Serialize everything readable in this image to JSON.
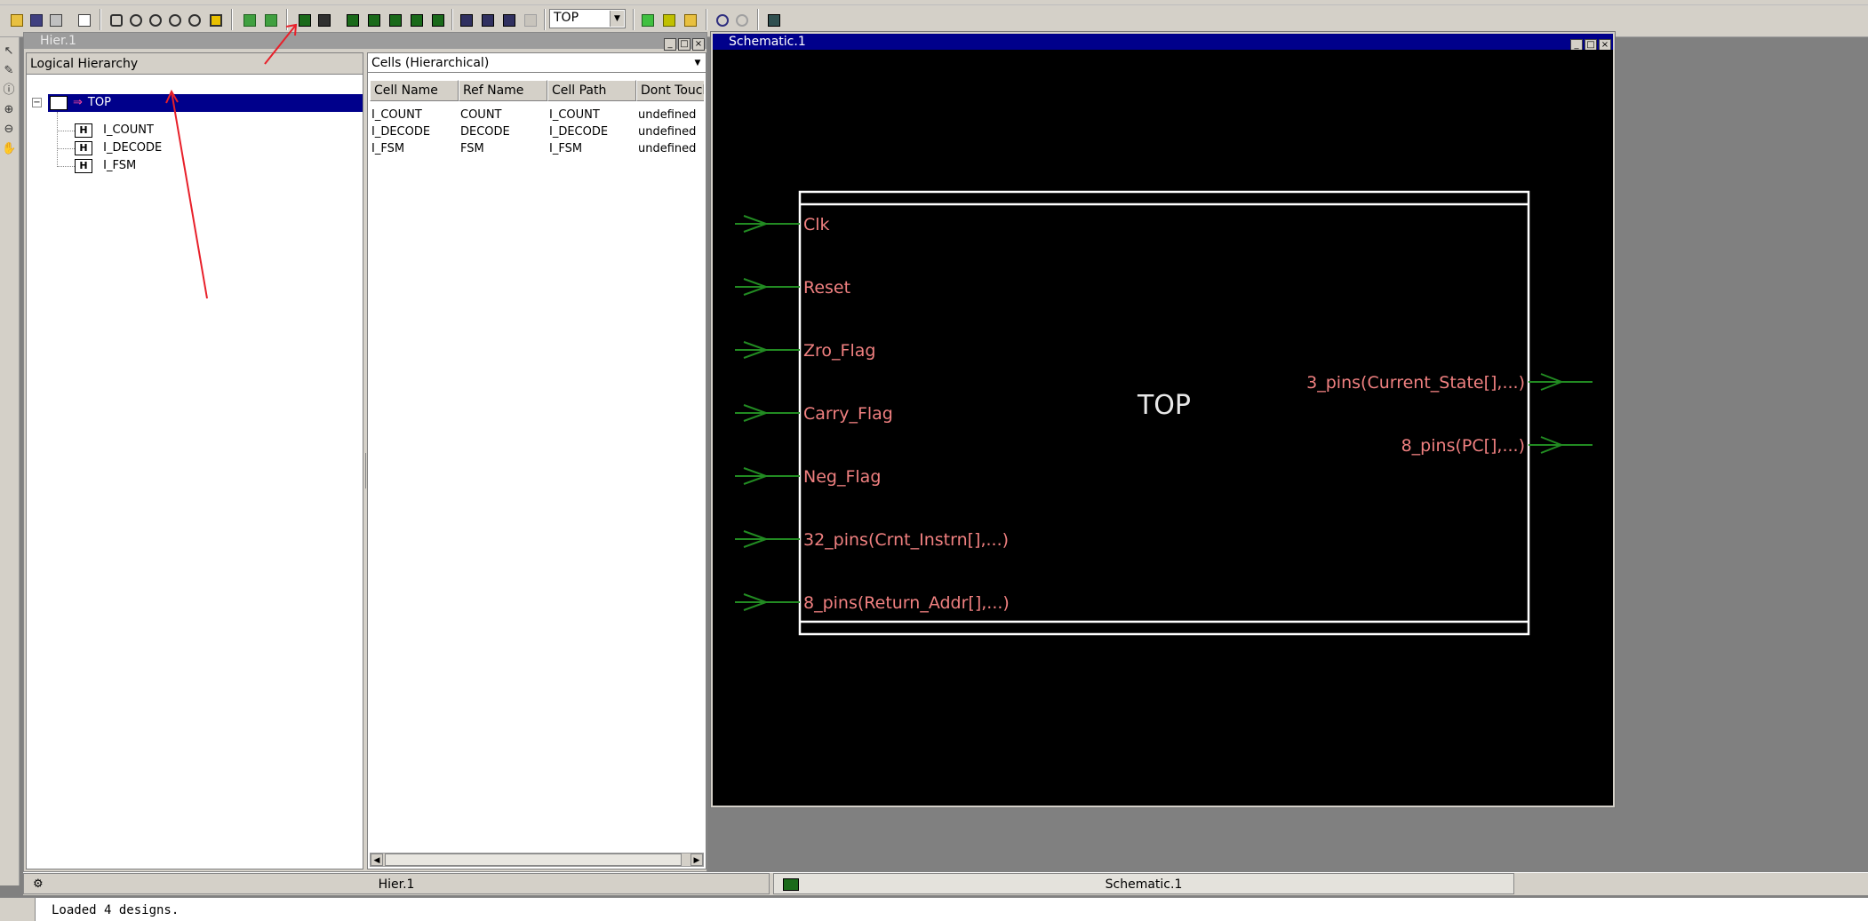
{
  "toolbar": {
    "design_select_value": "TOP"
  },
  "hier_window": {
    "title": "Hier.1",
    "left_panel_header": "Logical Hierarchy",
    "tree": {
      "root": {
        "badge": "H",
        "label": "TOP"
      },
      "children": [
        {
          "badge": "H",
          "label": "I_COUNT"
        },
        {
          "badge": "H",
          "label": "I_DECODE"
        },
        {
          "badge": "H",
          "label": "I_FSM"
        }
      ]
    },
    "cells_selector": "Cells (Hierarchical)",
    "table": {
      "columns": [
        "Cell Name",
        "Ref Name",
        "Cell Path",
        "Dont Touch"
      ],
      "rows": [
        [
          "I_COUNT",
          "COUNT",
          "I_COUNT",
          "undefined"
        ],
        [
          "I_DECODE",
          "DECODE",
          "I_DECODE",
          "undefined"
        ],
        [
          "I_FSM",
          "FSM",
          "I_FSM",
          "undefined"
        ]
      ]
    }
  },
  "schematic_window": {
    "title": "Schematic.1",
    "block_name": "TOP",
    "input_pins": [
      "Clk",
      "Reset",
      "Zro_Flag",
      "Carry_Flag",
      "Neg_Flag",
      "32_pins(Crnt_Instrn[],...)",
      "8_pins(Return_Addr[],...)"
    ],
    "output_pins": [
      "3_pins(Current_State[],...)",
      "8_pins(PC[],...)"
    ]
  },
  "bottom_tabs": [
    "Hier.1",
    "Schematic.1"
  ],
  "status": "Loaded 4 designs.",
  "colors": {
    "selection": "#00008b",
    "pin_label": "#f08080",
    "wire": "#228b22",
    "annotation": "#e8202a"
  }
}
